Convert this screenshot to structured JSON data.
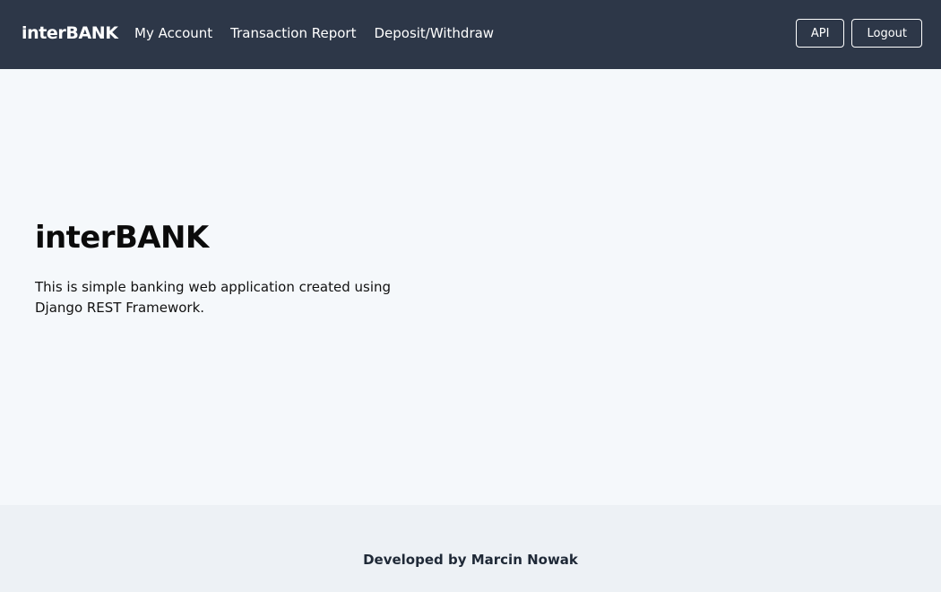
{
  "navbar": {
    "brand": "interBANK",
    "links": [
      "My Account",
      "Transaction Report",
      "Deposit/Withdraw"
    ],
    "buttons": {
      "api": "API",
      "logout": "Logout"
    },
    "background_color": "#2d3748"
  },
  "hero": {
    "title": "interBANK",
    "description": "This is simple banking web application created using Django REST Framework."
  },
  "footer": {
    "text": "Developed by Marcin Nowak"
  }
}
